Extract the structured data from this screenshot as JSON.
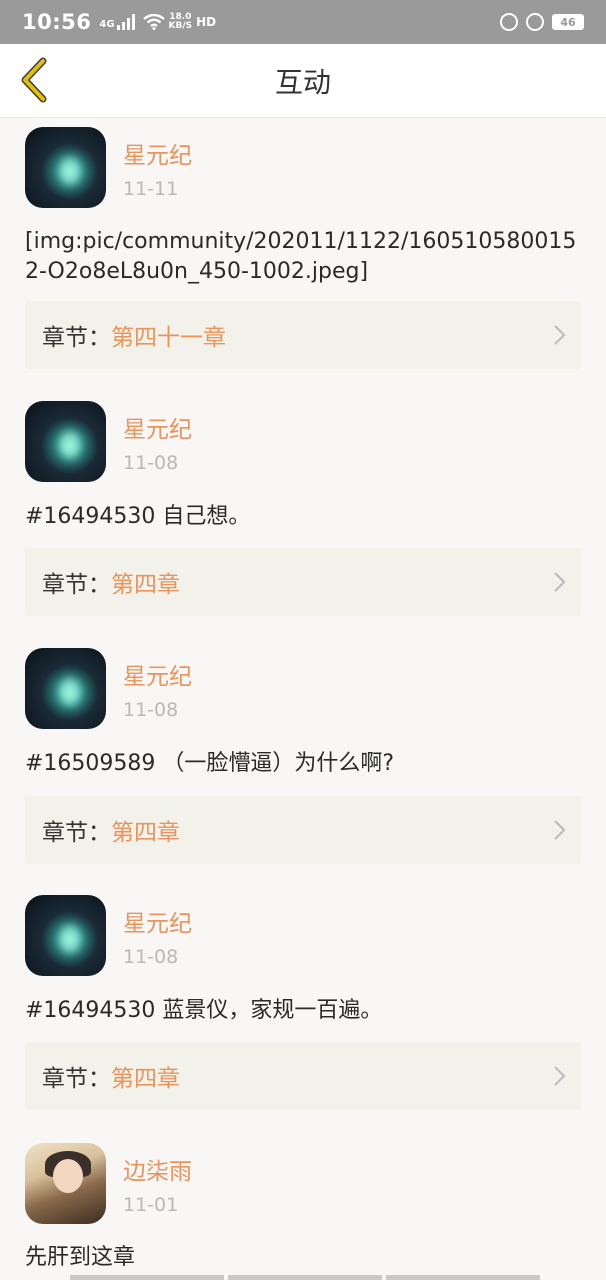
{
  "status": {
    "time": "10:56",
    "network": "4G",
    "speed_top": "18.0",
    "speed_bottom": "KB/S",
    "hd": "HD",
    "battery": "46"
  },
  "header": {
    "title": "互动"
  },
  "colors": {
    "accent": "#e8945c",
    "back_arrow": "#e2c200",
    "chapter_bg": "#f3f2ea"
  },
  "posts": [
    {
      "username": "星元纪",
      "date": "11-11",
      "content": "[img:pic/community/202011/1122/1605105800152-O2o8eL8u0n_450-1002.jpeg]",
      "chapter_label": "章节：",
      "chapter_name": "第四十一章"
    },
    {
      "username": "星元纪",
      "date": "11-08",
      "content": "#16494530 自己想。",
      "chapter_label": "章节：",
      "chapter_name": "第四章"
    },
    {
      "username": "星元纪",
      "date": "11-08",
      "content": "#16509589 （一脸懵逼）为什么啊?",
      "chapter_label": "章节：",
      "chapter_name": "第四章"
    },
    {
      "username": "星元纪",
      "date": "11-08",
      "content": "#16494530 蓝景仪，家规一百遍。",
      "chapter_label": "章节：",
      "chapter_name": "第四章"
    },
    {
      "username": "边柒雨",
      "date": "11-01",
      "content": "先肝到这章"
    }
  ]
}
